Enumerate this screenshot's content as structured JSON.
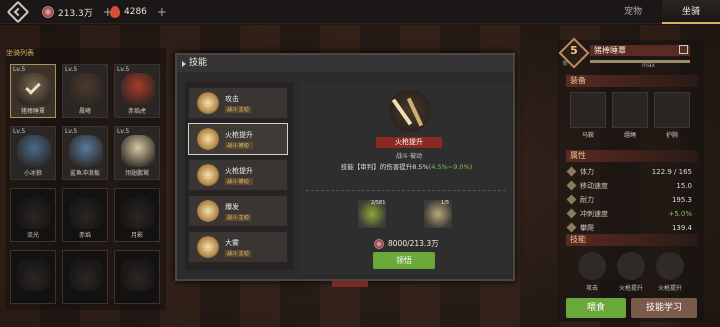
{
  "topbar": {
    "silver": "213.3万",
    "gems": "4286",
    "tabs": [
      "宠物",
      "坐骑"
    ],
    "active_tab": "坐骑"
  },
  "left_panel": {
    "title": "坐骑列表",
    "mounts": [
      {
        "level": "Lv.5",
        "name": "猪棒睡覃",
        "locked": false,
        "selected": true,
        "color": "#7a6a50"
      },
      {
        "level": "Lv.5",
        "name": "晨曦",
        "locked": false,
        "selected": false,
        "color": "#4a3a30"
      },
      {
        "level": "Lv.5",
        "name": "赤焰虎",
        "locked": false,
        "selected": false,
        "color": "#a83a2a"
      },
      {
        "level": "Lv.5",
        "name": "小冰狼",
        "locked": false,
        "selected": false,
        "color": "#4a6a8a"
      },
      {
        "level": "Lv.5",
        "name": "鲨鱼冲浪板",
        "locked": false,
        "selected": false,
        "color": "#5a7aa0"
      },
      {
        "level": "Lv.5",
        "name": "翎翅鹏鹫",
        "locked": false,
        "selected": false,
        "color": "#d8c8a0"
      },
      {
        "level": "",
        "name": "流光",
        "locked": true
      },
      {
        "level": "",
        "name": "赤焰",
        "locked": true
      },
      {
        "level": "",
        "name": "月影",
        "locked": true
      },
      {
        "level": "",
        "name": "",
        "locked": true
      },
      {
        "level": "",
        "name": "",
        "locked": true
      },
      {
        "level": "",
        "name": "",
        "locked": true
      }
    ]
  },
  "right_panel": {
    "rank": "5",
    "rank_label": "阶",
    "mount_name": "猪棒睡覃",
    "max_label": "max",
    "equip_title": "装备",
    "equipment": [
      "马鞍",
      "缰绳",
      "护腕"
    ],
    "attr_title": "属性",
    "attributes": [
      {
        "label": "体力",
        "value": "122.9 / 165",
        "green": false
      },
      {
        "label": "移动速度",
        "value": "15.0",
        "green": false
      },
      {
        "label": "耐力",
        "value": "195.3",
        "green": false
      },
      {
        "label": "冲刺速度",
        "value": "+5.0%",
        "green": true
      },
      {
        "label": "攀爬",
        "value": "139.4",
        "green": false
      }
    ],
    "skills_title": "技能",
    "skills": [
      "攻击",
      "火枪提升",
      "火枪提升"
    ],
    "feed_button": "喂食",
    "learn_button": "技能学习"
  },
  "modal": {
    "title": "技能",
    "skills": [
      {
        "name": "攻击",
        "tag": "战斗·主动",
        "selected": false
      },
      {
        "name": "火枪提升",
        "tag": "战斗·被动",
        "selected": true
      },
      {
        "name": "火枪提升",
        "tag": "战斗·被动",
        "selected": false
      },
      {
        "name": "爆发",
        "tag": "战斗·主动",
        "selected": false
      },
      {
        "name": "大雾",
        "tag": "战斗·主动",
        "selected": false
      }
    ],
    "detail": {
      "name": "火枪提升",
      "type": "战斗·被动",
      "desc_prefix": "技能【审判】的伤害提升8.5%",
      "desc_range": "(4.5%~9.0%)",
      "materials": [
        {
          "count": "2/581",
          "color": "#8aa838"
        },
        {
          "count": "1/5",
          "color": "#b8a878"
        }
      ],
      "cost": "8000/213.3万",
      "learn_button": "领悟"
    }
  }
}
